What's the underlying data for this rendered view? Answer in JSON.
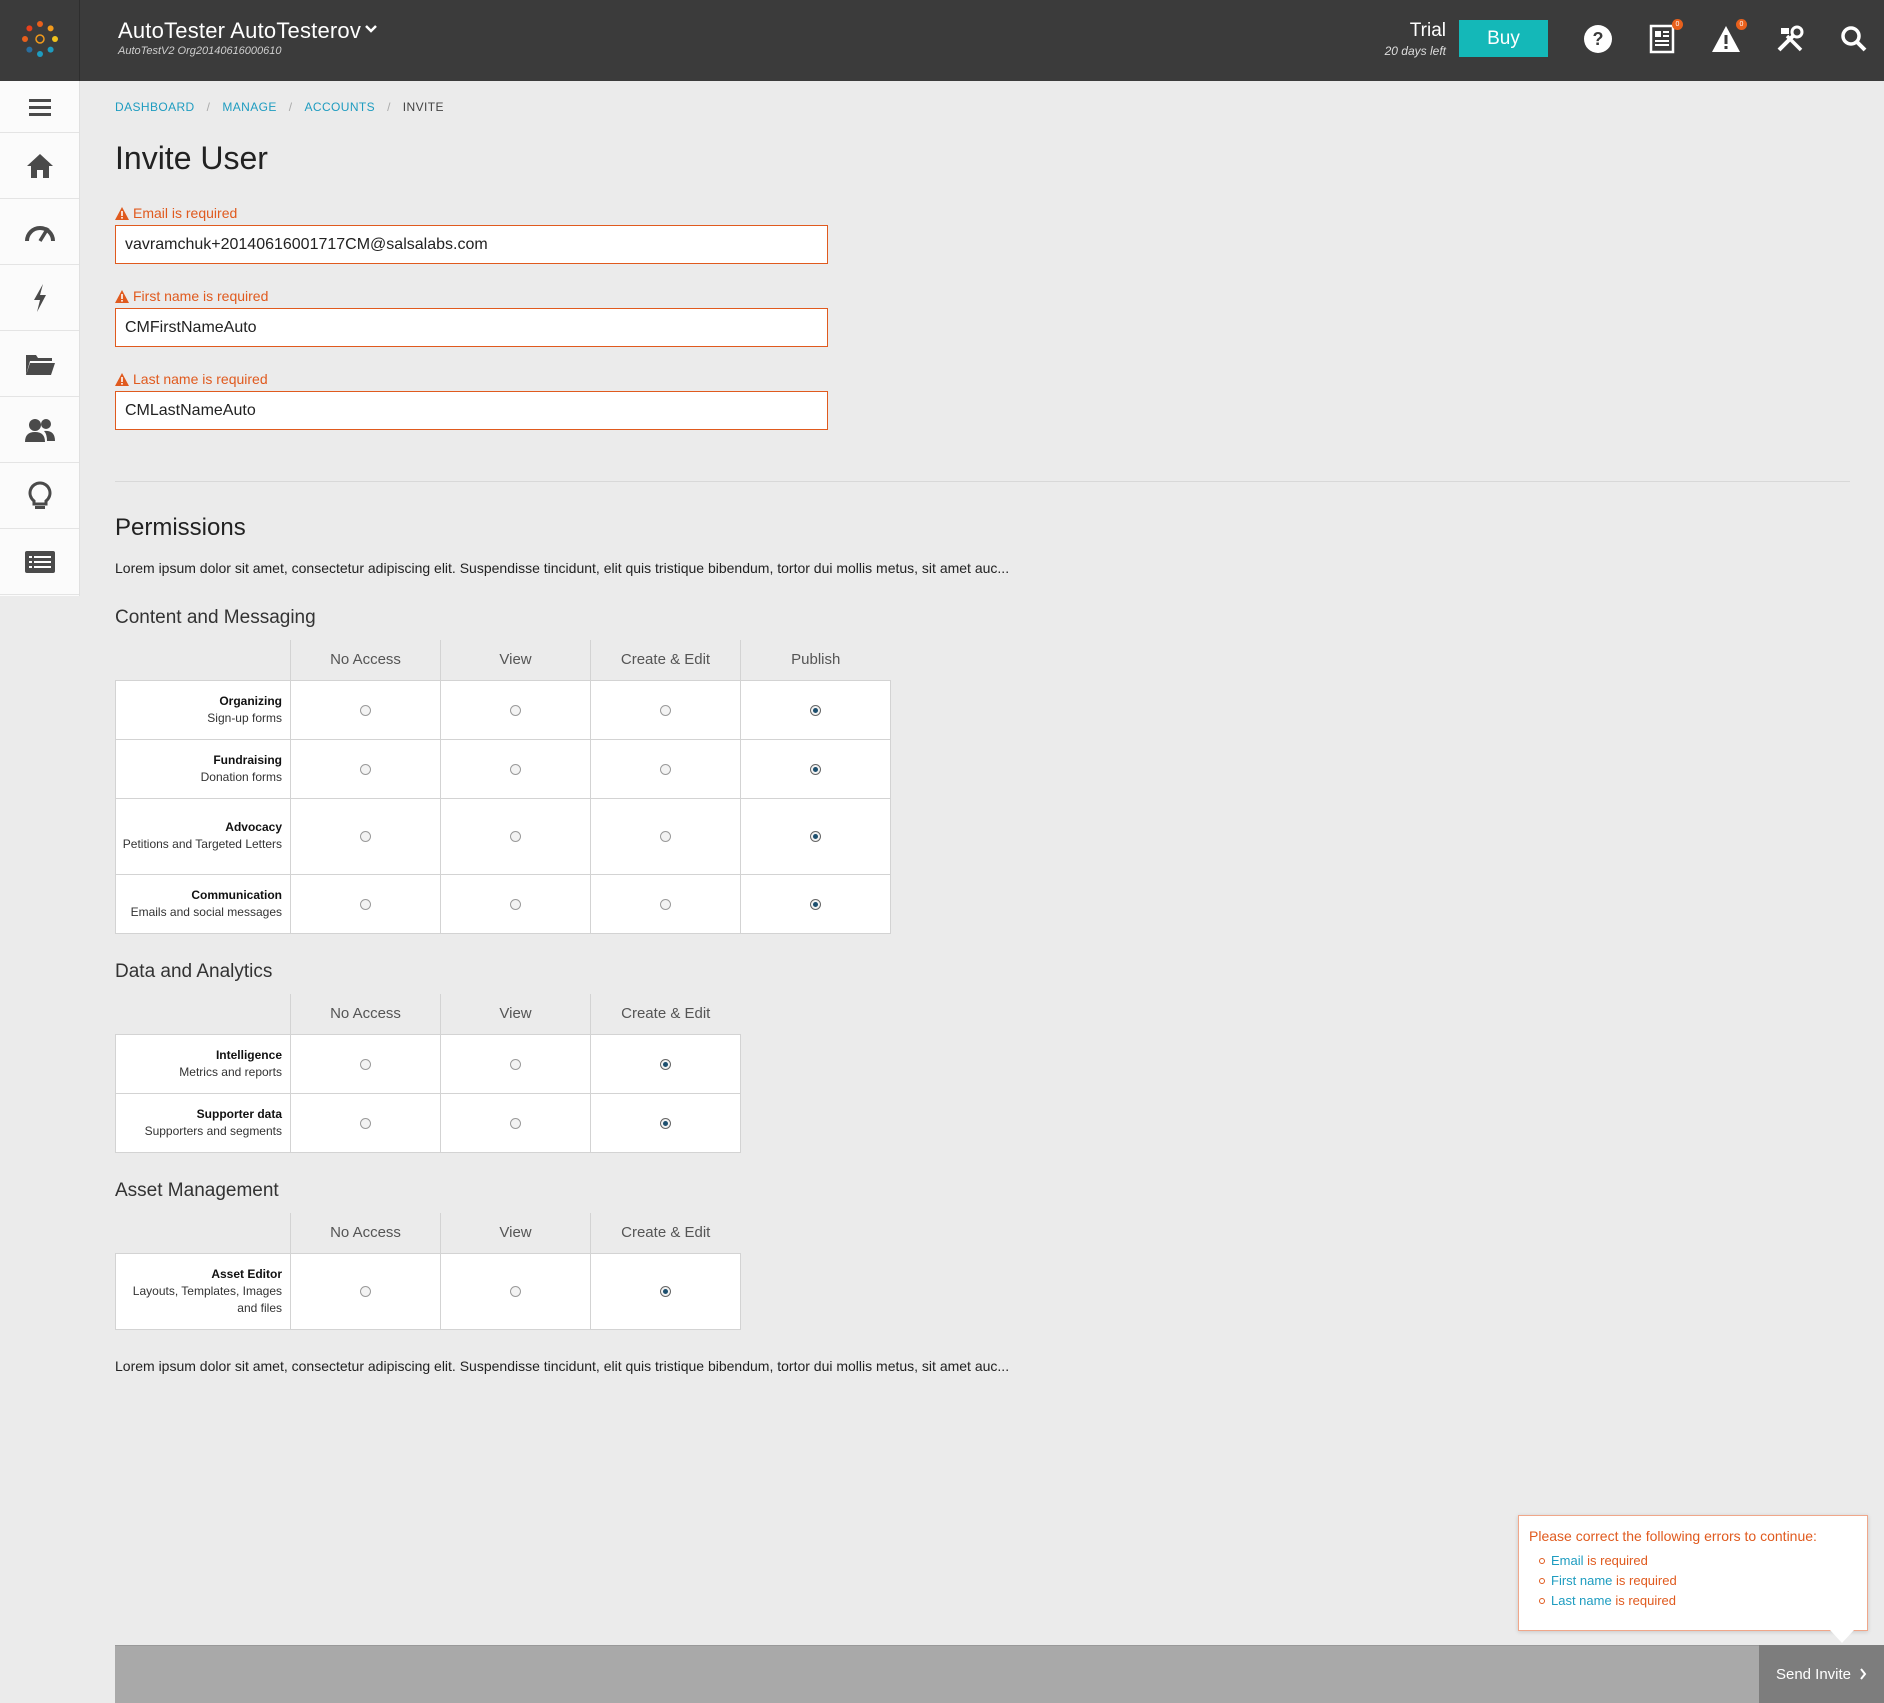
{
  "header": {
    "account_name": "AutoTester AutoTesterov",
    "org_name": "AutoTestV2 Org20140616000610",
    "trial_label": "Trial",
    "trial_days": "20 days left",
    "buy_label": "Buy",
    "news_badge": "0",
    "alert_badge": "0",
    "accent_color": "#14b8b8"
  },
  "sidebar": {
    "items": [
      "menu-icon",
      "home-icon",
      "dashboard-gauge-icon",
      "lightning-icon",
      "folder-icon",
      "people-icon",
      "lightbulb-icon",
      "list-icon"
    ]
  },
  "breadcrumb": {
    "items": [
      "DASHBOARD",
      "MANAGE",
      "ACCOUNTS"
    ],
    "current": "INVITE"
  },
  "page": {
    "title": "Invite User"
  },
  "form": {
    "email": {
      "error": "Email is required",
      "value": "vavramchuk+20140616001717CM@salsalabs.com"
    },
    "first_name": {
      "error": "First name is required",
      "value": "CMFirstNameAuto"
    },
    "last_name": {
      "error": "Last name is required",
      "value": "CMLastNameAuto"
    }
  },
  "permissions": {
    "title": "Permissions",
    "intro": "Lorem ipsum dolor sit amet, consectetur adipiscing elit. Suspendisse tincidunt, elit quis tristique bibendum, tortor dui mollis metus, sit amet auc...",
    "outro": "Lorem ipsum dolor sit amet, consectetur adipiscing elit. Suspendisse tincidunt, elit quis tristique bibendum, tortor dui mollis metus, sit amet auc...",
    "content": {
      "title": "Content and Messaging",
      "columns": [
        "No Access",
        "View",
        "Create & Edit",
        "Publish"
      ],
      "rows": [
        {
          "name": "Organizing",
          "desc": "Sign-up forms",
          "selected": "Publish"
        },
        {
          "name": "Fundraising",
          "desc": "Donation forms",
          "selected": "Publish"
        },
        {
          "name": "Advocacy",
          "desc": "Petitions and Targeted Letters",
          "selected": "Publish"
        },
        {
          "name": "Communication",
          "desc": "Emails and social messages",
          "selected": "Publish"
        }
      ]
    },
    "data": {
      "title": "Data and Analytics",
      "columns": [
        "No Access",
        "View",
        "Create & Edit"
      ],
      "rows": [
        {
          "name": "Intelligence",
          "desc": "Metrics and reports",
          "selected": "Create & Edit"
        },
        {
          "name": "Supporter data",
          "desc": "Supporters and segments",
          "selected": "Create & Edit"
        }
      ]
    },
    "assets": {
      "title": "Asset Management",
      "columns": [
        "No Access",
        "View",
        "Create & Edit"
      ],
      "rows": [
        {
          "name": "Asset Editor",
          "desc": "Layouts, Templates, Images and files",
          "selected": "Create & Edit"
        }
      ]
    }
  },
  "errors": {
    "heading": "Please correct the following errors to continue:",
    "items": [
      {
        "field": "Email",
        "text": " is required"
      },
      {
        "field": "First name",
        "text": " is required"
      },
      {
        "field": "Last name",
        "text": " is required"
      }
    ]
  },
  "footer": {
    "send_label": "Send Invite"
  }
}
